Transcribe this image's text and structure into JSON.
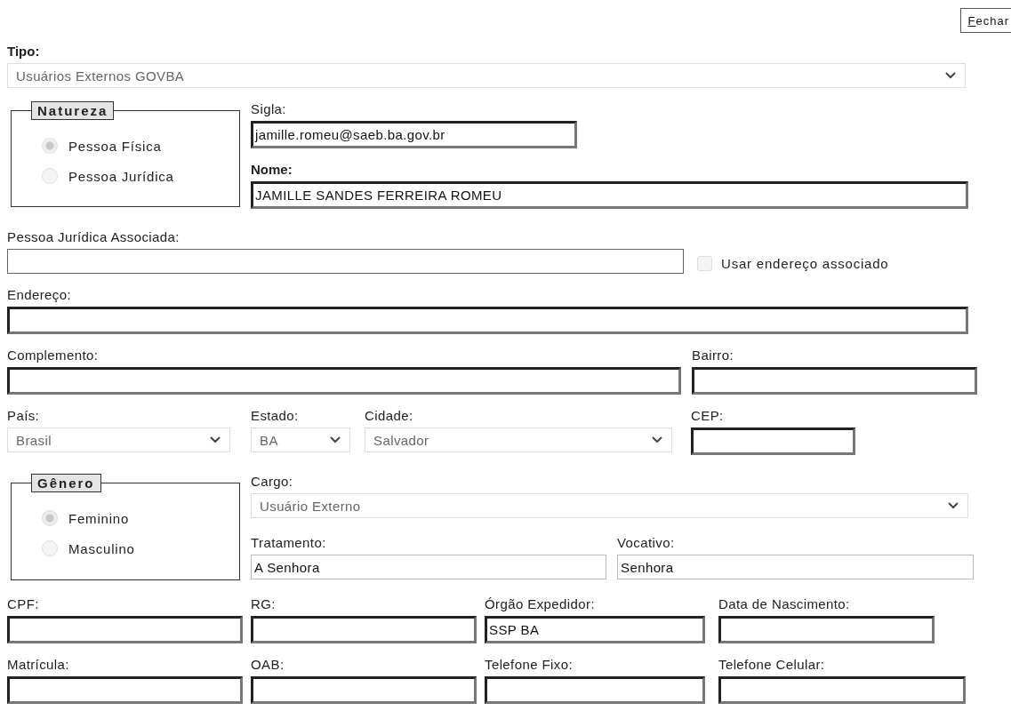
{
  "close_button": {
    "label": "Fechar"
  },
  "tipo": {
    "label": "Tipo:",
    "bold": true,
    "kind": "select",
    "value": "Usuários Externos GOVBA"
  },
  "natureza": {
    "legend": "Natureza",
    "options": [
      {
        "label": "Pessoa Física",
        "selected": true
      },
      {
        "label": "Pessoa Jurídica",
        "selected": false
      }
    ]
  },
  "sigla": {
    "label": "Sigla:",
    "bold": false,
    "kind": "sunken",
    "value": "jamille.romeu@saeb.ba.gov.br"
  },
  "nome": {
    "label": "Nome:",
    "bold": true,
    "kind": "sunken",
    "value": "JAMILLE SANDES FERREIRA ROMEU"
  },
  "pessoa_juridica_associada": {
    "label": "Pessoa Jurídica Associada:",
    "bold": false,
    "kind": "thin"
  },
  "usar_endereco_associado": {
    "label": "Usar endereço associado",
    "checked": false
  },
  "endereco": {
    "label": "Endereço:",
    "bold": false,
    "kind": "sunken"
  },
  "complemento": {
    "label": "Complemento:",
    "bold": false,
    "kind": "sunken"
  },
  "bairro": {
    "label": "Bairro:",
    "bold": false,
    "kind": "sunken"
  },
  "pais": {
    "label": "País:",
    "bold": false,
    "kind": "select",
    "value": "Brasil"
  },
  "estado": {
    "label": "Estado:",
    "bold": false,
    "kind": "select",
    "value": "BA"
  },
  "cidade": {
    "label": "Cidade:",
    "bold": false,
    "kind": "select",
    "value": "Salvador"
  },
  "cep": {
    "label": "CEP:",
    "bold": false,
    "kind": "sunken"
  },
  "genero": {
    "legend": "Gênero",
    "options": [
      {
        "label": "Feminino",
        "selected": true
      },
      {
        "label": "Masculino",
        "selected": false
      }
    ]
  },
  "cargo": {
    "label": "Cargo:",
    "bold": false,
    "kind": "select",
    "value": "Usuário Externo"
  },
  "tratamento": {
    "label": "Tratamento:",
    "bold": false,
    "kind": "light",
    "value": "A Senhora"
  },
  "vocativo": {
    "label": "Vocativo:",
    "bold": false,
    "kind": "light",
    "value": "Senhora"
  },
  "cpf": {
    "label": "CPF:",
    "bold": false,
    "kind": "sunken"
  },
  "rg": {
    "label": "RG:",
    "bold": false,
    "kind": "sunken"
  },
  "orgao_expedidor": {
    "label": "Órgão Expedidor:",
    "bold": false,
    "kind": "sunken",
    "value": "SSP BA"
  },
  "data_nascimento": {
    "label": "Data de Nascimento:",
    "bold": false,
    "kind": "sunken"
  },
  "matricula": {
    "label": "Matrícula:",
    "bold": false,
    "kind": "sunken"
  },
  "oab": {
    "label": "OAB:",
    "bold": false,
    "kind": "sunken"
  },
  "telefone_fixo": {
    "label": "Telefone Fixo:",
    "bold": false,
    "kind": "sunken"
  },
  "telefone_celular": {
    "label": "Telefone Celular:",
    "bold": false,
    "kind": "sunken"
  }
}
